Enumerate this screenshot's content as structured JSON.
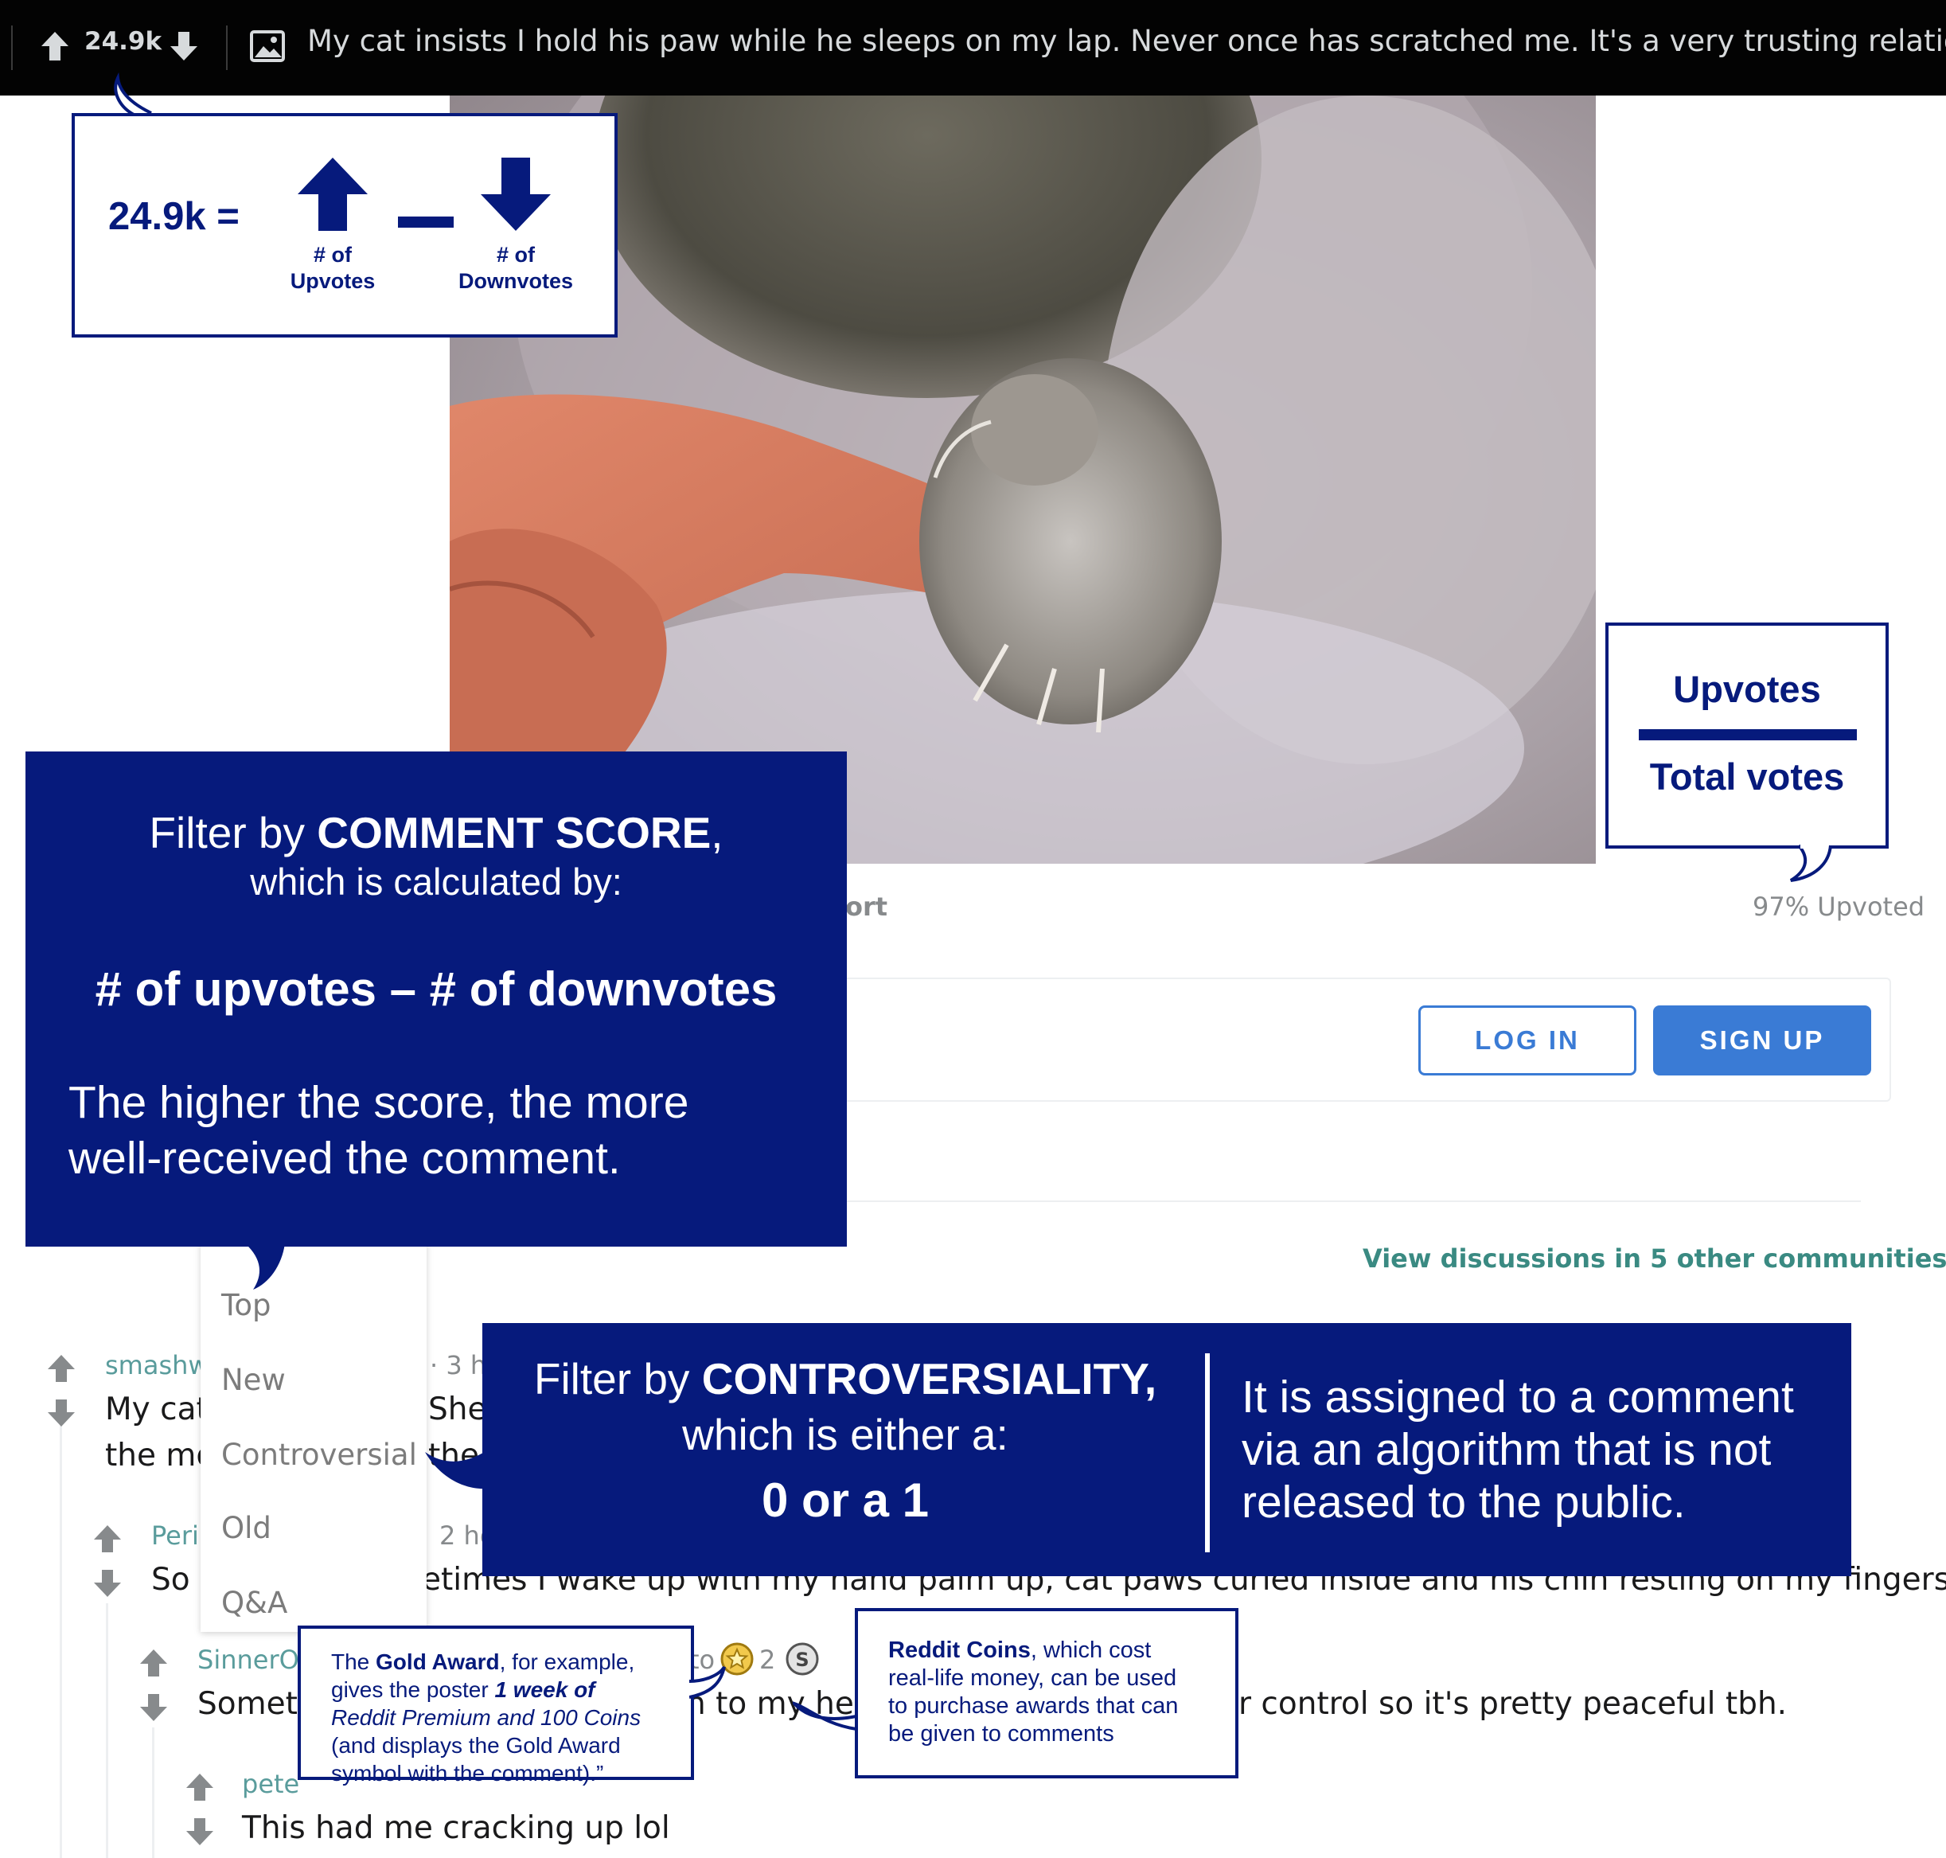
{
  "topbar": {
    "score": "24.9k",
    "post_title": "My cat insists I hold his paw while he sleeps on my lap. Never once has scratched me. It's a very trusting relationsh..."
  },
  "score_callout": {
    "value": "24.9k =",
    "upvotes_label_1": "# of",
    "upvotes_label_2": "Upvotes",
    "downvotes_label_1": "# of",
    "downvotes_label_2": "Downvotes"
  },
  "ratio_callout": {
    "numerator": "Upvotes",
    "denominator": "Total votes"
  },
  "post": {
    "report_fragment": "ort",
    "upvoted": "97% Upvoted"
  },
  "auth": {
    "login": "LOG IN",
    "signup": "SIGN UP"
  },
  "discussions_link": "View discussions in 5 other communities",
  "score_filter_callout": {
    "line1_prefix": "Filter by ",
    "line1_bold": "COMMENT SCORE",
    "line1_suffix": ",",
    "line2": "which is calculated by:",
    "formula": "# of upvotes – # of downvotes",
    "explain_1": "The higher the score, the more",
    "explain_2": "well-received the comment."
  },
  "sort_menu": [
    "Top",
    "New",
    "Controversial",
    "Old",
    "Q&A"
  ],
  "controversy_callout": {
    "line1_prefix": "Filter by ",
    "line1_bold": "CONTROVERSIALITY,",
    "line2": "which is either a:",
    "value": "0 or a 1",
    "right_1": "It is assigned to a comment",
    "right_2": "via an algorithm that is not",
    "right_3": "released to the public."
  },
  "comments": [
    {
      "user": "smashw",
      "time": "· 3 h",
      "text_left_1": "My cat",
      "text_left_2": "the mo",
      "text_right_1": "She",
      "text_right_2": "the"
    },
    {
      "user": "Peril",
      "time": "2 ho",
      "text_left": "So d",
      "text_right": "etimes I wake up with my hand palm up, cat paws curled inside and his chin resting on my fingers"
    },
    {
      "user": "SinnerOf",
      "meta_frag": "to",
      "award_count": "2",
      "text_left": "Someti",
      "text_mid": "n to my hea",
      "text_right": "r control so it's pretty peaceful tbh."
    },
    {
      "user": "pete",
      "text": "This had me cracking up lol"
    }
  ],
  "gold_callout": {
    "l1_a": "The ",
    "l1_b": "Gold Award",
    "l1_c": ", for example,",
    "l2_a": "gives the poster ",
    "l2_b": "1 week of",
    "l3": "Reddit Premium and 100 Coins",
    "l4": "(and displays the Gold Award",
    "l5": "symbol with the comment).”"
  },
  "coins_callout": {
    "l1_a": "Reddit Coins",
    "l1_b": ", which cost",
    "l2": "real-life money, can be used",
    "l3": "to purchase awards that can",
    "l4": "be given to comments"
  },
  "colors": {
    "navy": "#061a7c",
    "reddit_blue": "#3a7bd5",
    "teal": "#3a8a82",
    "topbar": "#030303"
  }
}
